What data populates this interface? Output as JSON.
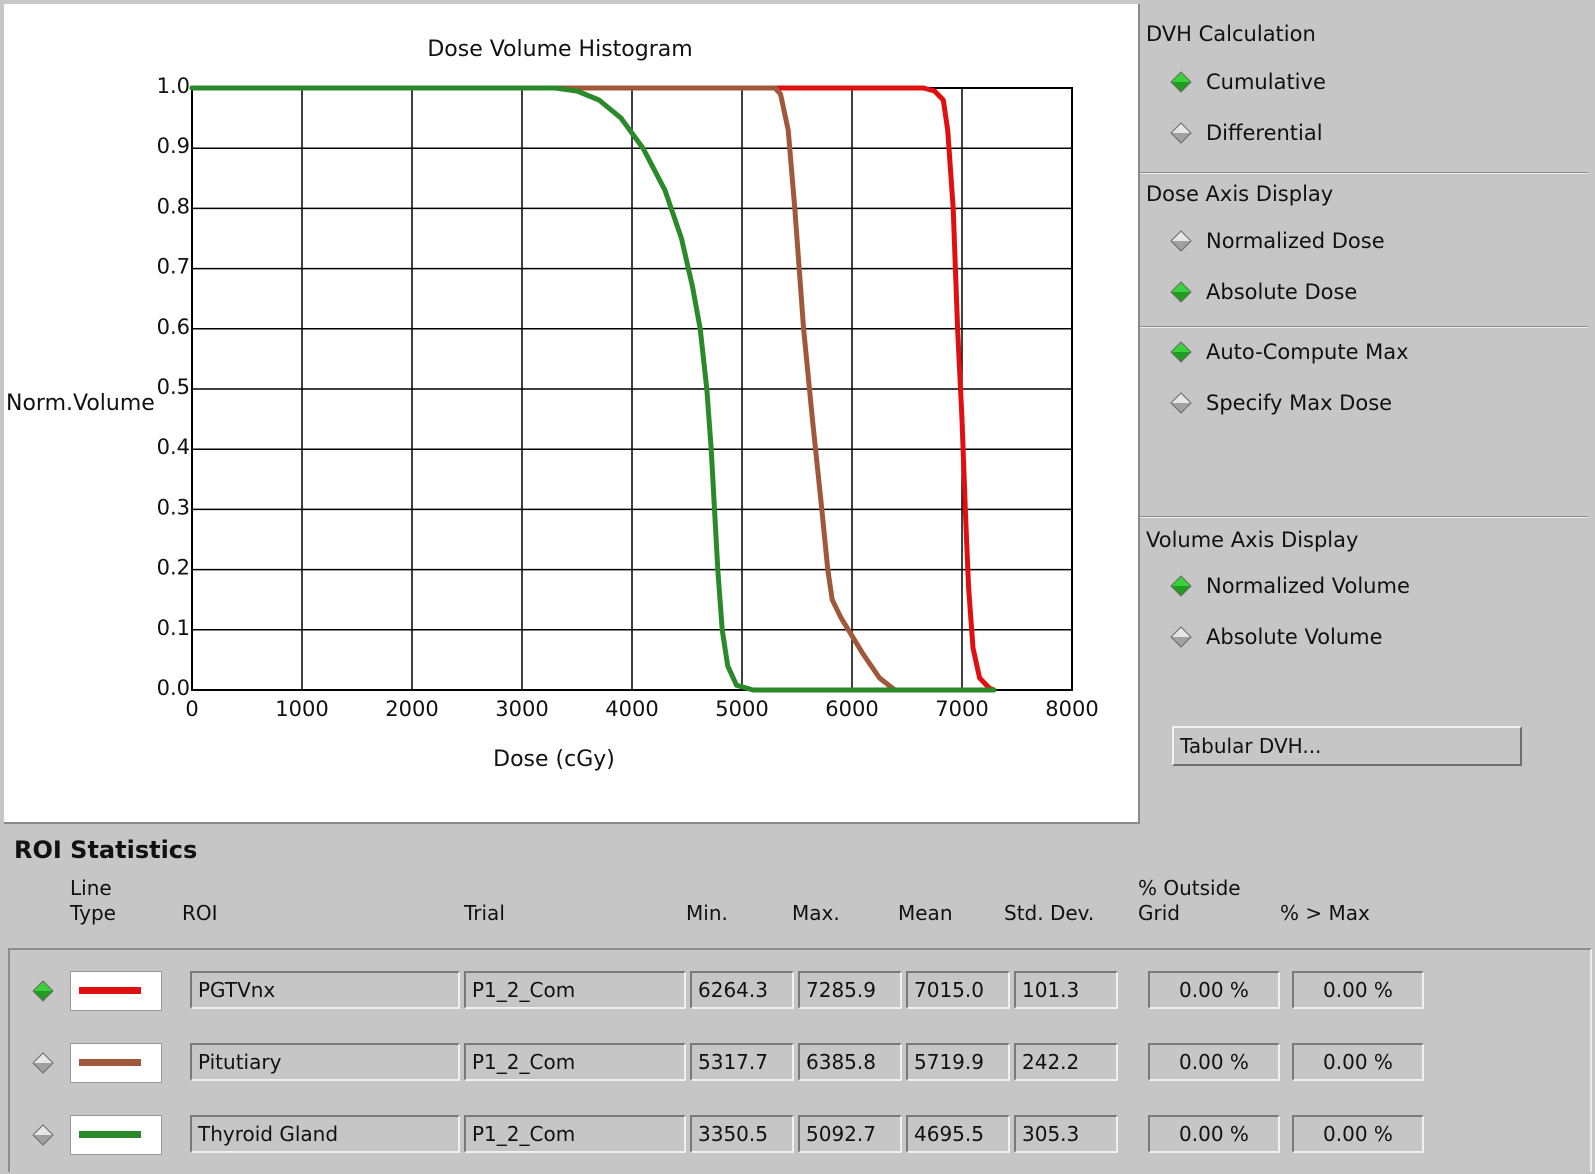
{
  "chart_data": {
    "type": "line",
    "title": "Dose Volume Histogram",
    "xlabel": "Dose (cGy)",
    "ylabel": "Norm.Volume",
    "xlim": [
      0,
      8000
    ],
    "ylim": [
      0,
      1.0
    ],
    "x_ticks": [
      "0",
      "1000",
      "2000",
      "3000",
      "4000",
      "5000",
      "6000",
      "7000",
      "8000"
    ],
    "y_ticks": [
      "0.0",
      "0.1",
      "0.2",
      "0.3",
      "0.4",
      "0.5",
      "0.6",
      "0.7",
      "0.8",
      "0.9",
      "1.0"
    ],
    "grid": true,
    "series": [
      {
        "name": "PGTVnx",
        "color": "#e01010",
        "points": [
          [
            0,
            1.0
          ],
          [
            6650,
            1.0
          ],
          [
            6750,
            0.995
          ],
          [
            6830,
            0.98
          ],
          [
            6870,
            0.93
          ],
          [
            6920,
            0.8
          ],
          [
            6960,
            0.6
          ],
          [
            7000,
            0.45
          ],
          [
            7030,
            0.3
          ],
          [
            7060,
            0.17
          ],
          [
            7100,
            0.07
          ],
          [
            7160,
            0.02
          ],
          [
            7250,
            0.003
          ],
          [
            7290,
            0.0
          ]
        ]
      },
      {
        "name": "Pituitary",
        "color": "#a0583a",
        "points": [
          [
            0,
            1.0
          ],
          [
            5300,
            1.0
          ],
          [
            5350,
            0.99
          ],
          [
            5420,
            0.93
          ],
          [
            5480,
            0.8
          ],
          [
            5560,
            0.6
          ],
          [
            5640,
            0.45
          ],
          [
            5720,
            0.31
          ],
          [
            5780,
            0.2
          ],
          [
            5820,
            0.15
          ],
          [
            5900,
            0.12
          ],
          [
            6000,
            0.09
          ],
          [
            6100,
            0.06
          ],
          [
            6250,
            0.02
          ],
          [
            6390,
            0.0
          ]
        ]
      },
      {
        "name": "Thyroid Gland",
        "color": "#2a8a2a",
        "points": [
          [
            0,
            1.0
          ],
          [
            3300,
            1.0
          ],
          [
            3500,
            0.995
          ],
          [
            3700,
            0.98
          ],
          [
            3900,
            0.95
          ],
          [
            4100,
            0.9
          ],
          [
            4300,
            0.83
          ],
          [
            4450,
            0.75
          ],
          [
            4550,
            0.67
          ],
          [
            4620,
            0.6
          ],
          [
            4680,
            0.5
          ],
          [
            4720,
            0.4
          ],
          [
            4750,
            0.3
          ],
          [
            4780,
            0.2
          ],
          [
            4820,
            0.1
          ],
          [
            4870,
            0.04
          ],
          [
            4950,
            0.008
          ],
          [
            5100,
            0.0
          ],
          [
            7290,
            0.0
          ]
        ]
      }
    ]
  },
  "side": {
    "dvh_calc": {
      "title": "DVH Calculation",
      "options": [
        {
          "label": "Cumulative",
          "selected": true
        },
        {
          "label": "Differential",
          "selected": false
        }
      ]
    },
    "dose_axis": {
      "title": "Dose Axis Display",
      "options": [
        {
          "label": "Normalized Dose",
          "selected": false
        },
        {
          "label": "Absolute Dose",
          "selected": true
        }
      ]
    },
    "max_dose": {
      "options": [
        {
          "label": "Auto-Compute Max",
          "selected": true
        },
        {
          "label": "Specify Max Dose",
          "selected": false
        }
      ]
    },
    "volume_axis": {
      "title": "Volume Axis Display",
      "options": [
        {
          "label": "Normalized Volume",
          "selected": true
        },
        {
          "label": "Absolute Volume",
          "selected": false
        }
      ]
    },
    "tabular_button": "Tabular DVH..."
  },
  "stats": {
    "title": "ROI Statistics",
    "headers": {
      "line_type_1": "Line",
      "line_type_2": "Type",
      "roi": "ROI",
      "trial": "Trial",
      "min": "Min.",
      "max": "Max.",
      "mean": "Mean",
      "std": "Std. Dev.",
      "outside_1": "% Outside",
      "outside_2": "Grid",
      "gt_max": "% > Max"
    },
    "rows": [
      {
        "selected": true,
        "color": "#e01010",
        "roi": "PGTVnx",
        "trial": "P1_2_Com",
        "min": "6264.3",
        "max": "7285.9",
        "mean": "7015.0",
        "std": "101.3",
        "outside": "0.00 %",
        "gt_max": "0.00 %"
      },
      {
        "selected": false,
        "color": "#a0583a",
        "roi": "Pitutiary",
        "trial": "P1_2_Com",
        "min": "5317.7",
        "max": "6385.8",
        "mean": "5719.9",
        "std": "242.2",
        "outside": "0.00 %",
        "gt_max": "0.00 %"
      },
      {
        "selected": false,
        "color": "#2a8a2a",
        "roi": "Thyroid Gland",
        "trial": "P1_2_Com",
        "min": "3350.5",
        "max": "5092.7",
        "mean": "4695.5",
        "std": "305.3",
        "outside": "0.00 %",
        "gt_max": "0.00 %"
      }
    ]
  }
}
